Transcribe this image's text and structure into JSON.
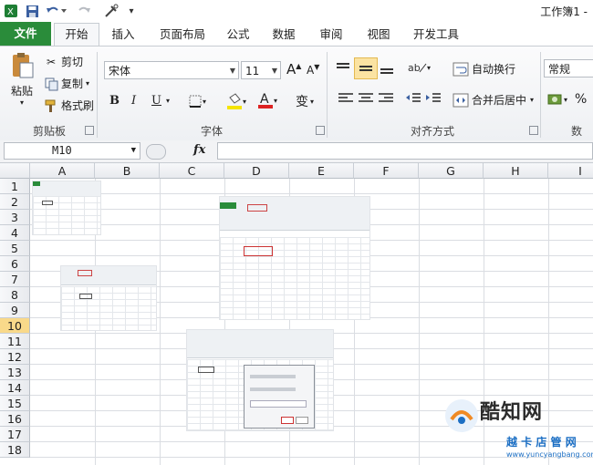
{
  "title_bar": {
    "title": "工作簿1 -",
    "icons": [
      "excel-icon",
      "save-icon",
      "undo-icon",
      "redo-icon",
      "tools-icon",
      "customize-icon"
    ]
  },
  "tabs": [
    "文件",
    "开始",
    "插入",
    "页面布局",
    "公式",
    "数据",
    "审阅",
    "视图",
    "开发工具"
  ],
  "active_tab": "开始",
  "ribbon": {
    "clipboard": {
      "paste": "粘贴",
      "cut": "剪切",
      "copy": "复制",
      "format_painter": "格式刷",
      "group": "剪贴板"
    },
    "font": {
      "name": "宋体",
      "size": "11",
      "bold": "B",
      "italic": "I",
      "underline": "U",
      "wen": "变",
      "group": "字体"
    },
    "alignment": {
      "wrap": "自动换行",
      "merge": "合并后居中",
      "group": "对齐方式"
    },
    "number": {
      "format": "常规",
      "percent": "%",
      "group": "数"
    }
  },
  "formula_bar": {
    "name_box": "M10",
    "fx": "fx",
    "value": ""
  },
  "columns": [
    "A",
    "B",
    "C",
    "D",
    "E",
    "F",
    "G",
    "H",
    "I"
  ],
  "rows": [
    "1",
    "2",
    "3",
    "4",
    "5",
    "6",
    "7",
    "8",
    "9",
    "10",
    "11",
    "12",
    "13",
    "14",
    "15",
    "16",
    "17",
    "18"
  ],
  "selected_row": "10",
  "watermark": {
    "text": "酷知网",
    "sub": "越 卡 店 管 网",
    "url": "www.yuncyangbang.com"
  },
  "colors": {
    "file_tab": "#2a8c3a",
    "selected_row": "#f9d98a",
    "font_color_red": "#d22",
    "highlight_yellow": "#f5e400"
  }
}
